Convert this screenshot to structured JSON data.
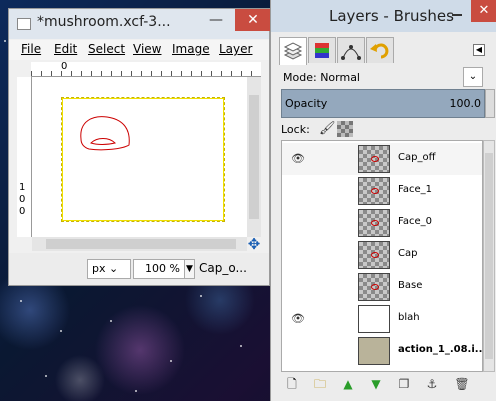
{
  "image_window": {
    "title": "*mushroom.xcf-3...",
    "menu": [
      "File",
      "Edit",
      "Select",
      "View",
      "Image",
      "Layer"
    ],
    "ruler_h_label": "0",
    "ruler_v_labels": [
      "1",
      "0",
      "0"
    ],
    "unit": "px",
    "zoom": "100 %",
    "active_layer": "Cap_o..."
  },
  "dock": {
    "title": "Layers - Brushes",
    "mode_label": "Mode:",
    "mode_value": "Normal",
    "opacity_label": "Opacity",
    "opacity_value": "100.0",
    "lock_label": "Lock:",
    "layers": [
      {
        "name": "Cap_off",
        "visible": true,
        "thumb": "checker",
        "selected": true
      },
      {
        "name": "Face_1",
        "visible": false,
        "thumb": "checker"
      },
      {
        "name": "Face_0",
        "visible": false,
        "thumb": "checker"
      },
      {
        "name": "Cap",
        "visible": false,
        "thumb": "checker"
      },
      {
        "name": "Base",
        "visible": false,
        "thumb": "checker"
      },
      {
        "name": "blah",
        "visible": true,
        "thumb": "white"
      },
      {
        "name": "action_1_.08.i...",
        "visible": false,
        "thumb": "photo"
      }
    ]
  },
  "icons": {
    "eye": "eye-icon",
    "brush": "paintbrush-icon",
    "alpha": "alpha-lock-icon",
    "navigate": "navigate-icon"
  },
  "colors": {
    "selection_red": "#cc0000",
    "opacity_bar": "#94a8bd",
    "close_button": "#c94c40"
  }
}
